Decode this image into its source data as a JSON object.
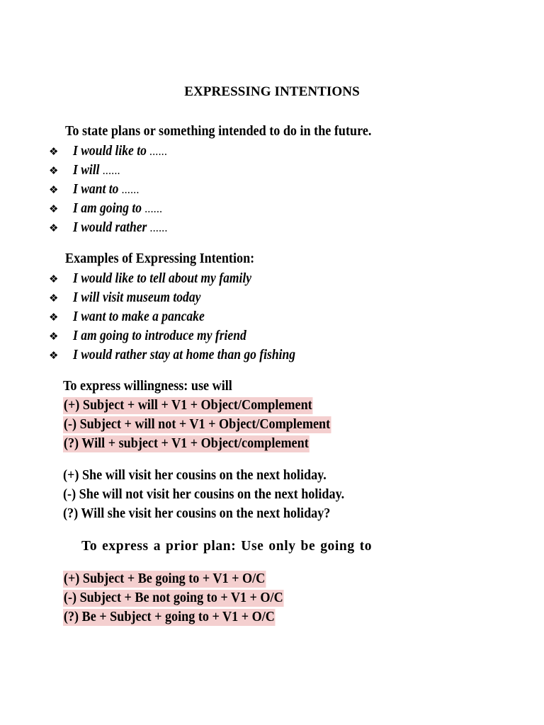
{
  "document": {
    "title": "EXPRESSING INTENTIONS",
    "highlight_color": "#f4cfcf",
    "text_color": "#000000",
    "background_color": "#ffffff",
    "bullet_glyph": "❖"
  },
  "sections": {
    "intro": {
      "heading": "To state plans or something intended to do in the future.",
      "items": [
        {
          "phrase": "I would like to",
          "trailing": " ......"
        },
        {
          "phrase": "I will",
          "trailing": " ......"
        },
        {
          "phrase": "I want to",
          "trailing": " ......"
        },
        {
          "phrase": "I am going to",
          "trailing": " ......"
        },
        {
          "phrase": "I would rather",
          "trailing": " ......"
        }
      ]
    },
    "examples": {
      "heading": "Examples of Expressing Intention:",
      "items": [
        {
          "phrase": "I would like to tell  about my family",
          "trailing": ""
        },
        {
          "phrase": "I will visit museum today",
          "trailing": ""
        },
        {
          "phrase": "I want to make  a pancake",
          "trailing": ""
        },
        {
          "phrase": "I am going to  introduce  my friend",
          "trailing": ""
        },
        {
          "phrase": "I would rather stay  at home than go fishing",
          "trailing": ""
        }
      ]
    },
    "willingness": {
      "heading": "To express willingness: use will",
      "formulas": [
        "(+) Subject + will + V1 + Object/Complement",
        "(-)  Subject + will not + V1 + Object/Complement",
        "(?) Will + subject + V1 + Object/complement"
      ],
      "examples": [
        "(+) She will visit her cousins on the next holiday.",
        "(-) She will not visit her cousins on the next holiday.",
        "(?) Will she visit her cousins on the next holiday?"
      ]
    },
    "prior_plan": {
      "heading": "To express a prior plan: Use only be going to",
      "formulas": [
        "(+) Subject + Be going to + V1 + O/C",
        "(-) Subject + Be not going to + V1 + O/C",
        "(?) Be + Subject + going to + V1 + O/C"
      ]
    }
  }
}
